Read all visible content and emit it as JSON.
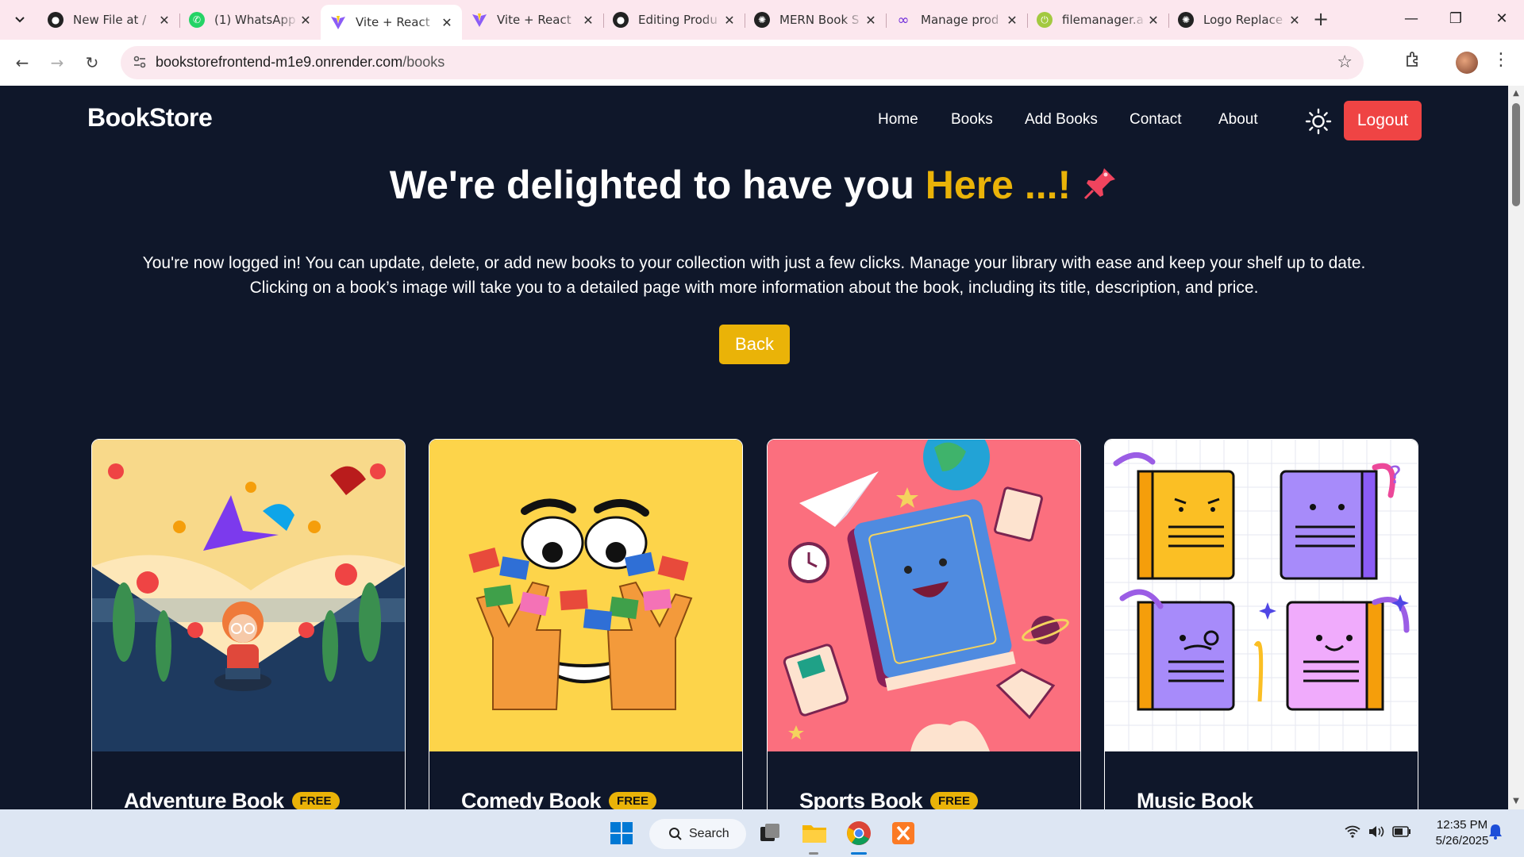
{
  "browser": {
    "tabs": [
      {
        "title": "New File at /",
        "favicon": "github-icon",
        "active": false
      },
      {
        "title": "(1) WhatsApp",
        "favicon": "whatsapp-icon",
        "active": false
      },
      {
        "title": "Vite + React",
        "favicon": "vite-icon",
        "active": true
      },
      {
        "title": "Vite + React",
        "favicon": "vite-icon",
        "active": false
      },
      {
        "title": "Editing Produ",
        "favicon": "github-icon",
        "active": false
      },
      {
        "title": "MERN Book S",
        "favicon": "openai-icon",
        "active": false
      },
      {
        "title": "Manage prod",
        "favicon": "infinity-icon",
        "active": false
      },
      {
        "title": "filemanager.a",
        "favicon": "filemanager-icon",
        "active": false
      },
      {
        "title": "Logo Replace",
        "favicon": "openai-icon",
        "active": false
      }
    ],
    "url_host": "bookstorefrontend-m1e9.onrender.com",
    "url_path": "/books"
  },
  "header": {
    "brand": "BookStore",
    "nav": [
      "Home",
      "Books",
      "Add Books",
      "Contact",
      "About"
    ],
    "logout_label": "Logout"
  },
  "hero": {
    "title_main": "We're delighted to have you ",
    "title_accent": "Here ...!",
    "line1": "You're now logged in! You can update, delete, or add new books to your collection with just a few clicks. Manage your library with ease and keep your shelf up to date.",
    "line2": "Clicking on a book’s image will take you to a detailed page with more information about the book, including its title, description, and price.",
    "back_label": "Back"
  },
  "books": [
    {
      "title": "Adventure Book",
      "badge": "FREE"
    },
    {
      "title": "Comedy Book",
      "badge": "FREE"
    },
    {
      "title": "Sports Book",
      "badge": "FREE"
    },
    {
      "title": "Music Book",
      "badge": ""
    }
  ],
  "taskbar": {
    "search_label": "Search",
    "time": "12:35 PM",
    "date": "5/26/2025"
  },
  "colors": {
    "page_bg": "#0f172a",
    "accent_yellow": "#eab308",
    "logout_red": "#ef4444",
    "tabbar_bg": "#fce7ee"
  }
}
